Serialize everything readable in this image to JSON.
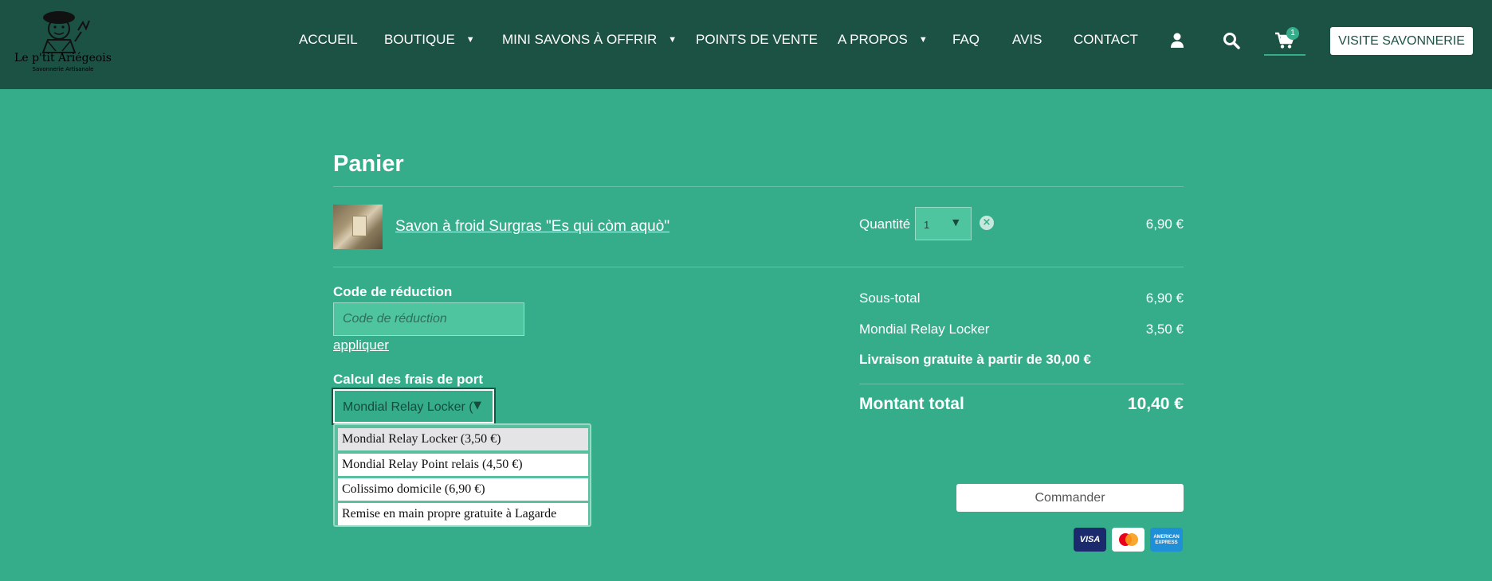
{
  "header": {
    "logo": {
      "title": "Le p'tit Ariégeois",
      "subtitle": "Savonnerie Artisanale"
    },
    "nav": [
      {
        "label": "ACCUEIL"
      },
      {
        "label": "BOUTIQUE",
        "has_submenu": true
      },
      {
        "label": "MINI SAVONS À OFFRIR",
        "has_submenu": true
      },
      {
        "label": "POINTS DE VENTE"
      },
      {
        "label": "A PROPOS",
        "has_submenu": true
      },
      {
        "label": "FAQ"
      },
      {
        "label": "AVIS"
      },
      {
        "label": "CONTACT"
      }
    ],
    "icons": [
      "user-icon",
      "search-icon",
      "cart-icon"
    ],
    "cart_count": "1",
    "visit_button": "VISITE SAVONNERIE"
  },
  "cart": {
    "title": "Panier",
    "item": {
      "name": "Savon à froid Surgras \"Es qui còm aquò\"",
      "quantity_label": "Quantité",
      "quantity": "1",
      "price": "6,90 €"
    }
  },
  "coupon": {
    "label": "Code de réduction",
    "placeholder": "Code de réduction",
    "apply": "appliquer"
  },
  "shipping": {
    "label": "Calcul des frais de port",
    "selected": "Mondial Relay Locker (3,50 €)",
    "options": [
      "Mondial Relay Locker (3,50 €)",
      "Mondial Relay Point relais (4,50 €)",
      "Colissimo domicile (6,90 €)",
      "Remise en main propre gratuite à Lagarde"
    ]
  },
  "summary": {
    "subtotal_label": "Sous-total",
    "subtotal": "6,90 €",
    "shipping_label": "Mondial Relay Locker",
    "shipping_cost": "3,50 €",
    "free_shipping": "Livraison gratuite à partir de 30,00 €",
    "total_label": "Montant total",
    "total": "10,40 €",
    "order_button": "Commander"
  },
  "payment_icons": [
    "visa-icon",
    "mastercard-icon",
    "amex-icon"
  ],
  "payment_card_text": {
    "visa": "VISA",
    "amex": "AMERICAN EXPRESS"
  },
  "colors": {
    "header_bg": "#1b5243",
    "page_bg": "#35ad8a",
    "input_bg": "#4ec59f"
  }
}
